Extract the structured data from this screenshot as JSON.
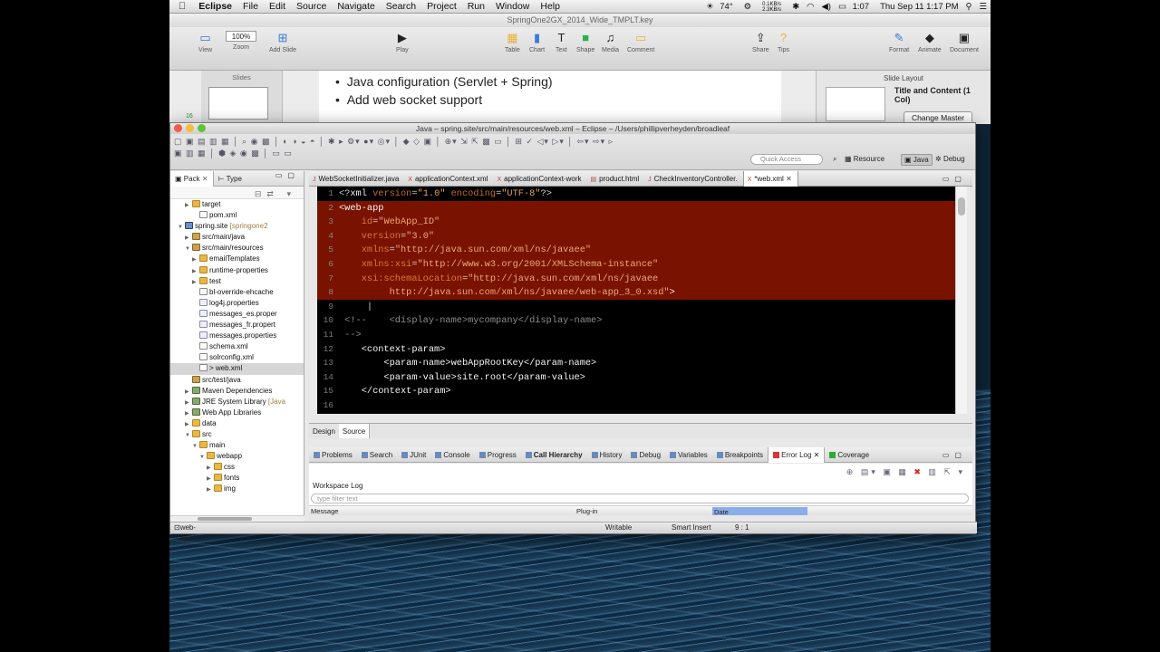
{
  "menubar": {
    "app": "Eclipse",
    "items": [
      "File",
      "Edit",
      "Source",
      "Navigate",
      "Search",
      "Project",
      "Run",
      "Window",
      "Help"
    ],
    "status": {
      "temp": "74°",
      "net_up": "0.1KB/s",
      "net_down": "2.3KB/s",
      "battery_time": "1:07",
      "datetime": "Thu Sep 11  1:17 PM"
    }
  },
  "keynote": {
    "title": "SpringOne2GX_2014_Wide_TMPLT.key",
    "toolbar": [
      {
        "label": "View",
        "icon": "view-icon"
      },
      {
        "label": "Zoom",
        "icon": "zoom-icon",
        "value": "100%"
      },
      {
        "label": "Add Slide",
        "icon": "plus-icon"
      },
      {
        "label": "Play",
        "icon": "play-icon"
      },
      {
        "label": "Table",
        "icon": "table-icon"
      },
      {
        "label": "Chart",
        "icon": "chart-icon"
      },
      {
        "label": "Text",
        "icon": "text-icon"
      },
      {
        "label": "Shape",
        "icon": "shape-icon"
      },
      {
        "label": "Media",
        "icon": "media-icon"
      },
      {
        "label": "Comment",
        "icon": "comment-icon"
      },
      {
        "label": "Share",
        "icon": "share-icon"
      },
      {
        "label": "Tips",
        "icon": "tips-icon"
      },
      {
        "label": "Format",
        "icon": "format-icon"
      },
      {
        "label": "Animate",
        "icon": "animate-icon"
      },
      {
        "label": "Document",
        "icon": "document-icon"
      }
    ],
    "slides_header": "Slides",
    "slide_number": "16",
    "bullets": [
      "Java configuration (Servlet + Spring)",
      "Add web socket support"
    ],
    "layout_header": "Slide Layout",
    "layout_name": "Title and Content (1 Col)",
    "change_master": "Change Master"
  },
  "eclipse": {
    "title": "Java – spring.site/src/main/resources/web.xml – Eclipse – /Users/phillipverheyden/broadleaf",
    "quick_access": "Quick Access",
    "perspectives": [
      "Resource",
      "Java",
      "Debug"
    ],
    "left_tabs": [
      "Pack",
      "Type"
    ],
    "tree": [
      {
        "label": "target",
        "type": "folder",
        "indent": 2,
        "tw": "▶"
      },
      {
        "label": "pom.xml",
        "type": "xml",
        "indent": 3,
        "tw": ""
      },
      {
        "label": "spring.site",
        "extra": "[springone2",
        "type": "proj",
        "indent": 1,
        "tw": "▼"
      },
      {
        "label": "src/main/java",
        "type": "pkgf",
        "indent": 2,
        "tw": "▶"
      },
      {
        "label": "src/main/resources",
        "type": "pkgf",
        "indent": 2,
        "tw": "▼"
      },
      {
        "label": "emailTemplates",
        "type": "folder",
        "indent": 3,
        "tw": "▶"
      },
      {
        "label": "runtime-properties",
        "type": "folder",
        "indent": 3,
        "tw": "▶"
      },
      {
        "label": "test",
        "type": "folder",
        "indent": 3,
        "tw": "▶"
      },
      {
        "label": "bl-override-ehcache",
        "type": "xml",
        "indent": 3,
        "tw": ""
      },
      {
        "label": "log4j.properties",
        "type": "prop",
        "indent": 3,
        "tw": ""
      },
      {
        "label": "messages_es.proper",
        "type": "prop",
        "indent": 3,
        "tw": ""
      },
      {
        "label": "messages_fr.propert",
        "type": "prop",
        "indent": 3,
        "tw": ""
      },
      {
        "label": "messages.properties",
        "type": "prop",
        "indent": 3,
        "tw": ""
      },
      {
        "label": "schema.xml",
        "type": "xml",
        "indent": 3,
        "tw": ""
      },
      {
        "label": "solrconfig.xml",
        "type": "xml",
        "indent": 3,
        "tw": ""
      },
      {
        "label": "> web.xml",
        "type": "xml",
        "indent": 3,
        "tw": "",
        "selected": true
      },
      {
        "label": "src/test/java",
        "type": "pkgf",
        "indent": 2,
        "tw": ""
      },
      {
        "label": "Maven Dependencies",
        "type": "lib",
        "indent": 2,
        "tw": "▶"
      },
      {
        "label": "JRE System Library",
        "extra": "[Java",
        "type": "lib",
        "indent": 2,
        "tw": "▶"
      },
      {
        "label": "Web App Libraries",
        "type": "lib",
        "indent": 2,
        "tw": "▶"
      },
      {
        "label": "data",
        "type": "folder",
        "indent": 2,
        "tw": "▶"
      },
      {
        "label": "src",
        "type": "folder",
        "indent": 2,
        "tw": "▼"
      },
      {
        "label": "main",
        "type": "folder",
        "indent": 3,
        "tw": "▼"
      },
      {
        "label": "webapp",
        "type": "folder",
        "indent": 4,
        "tw": "▼"
      },
      {
        "label": "css",
        "type": "folder",
        "indent": 5,
        "tw": "▶"
      },
      {
        "label": "fonts",
        "type": "folder",
        "indent": 5,
        "tw": "▶"
      },
      {
        "label": "img",
        "type": "folder",
        "indent": 5,
        "tw": "▶"
      }
    ],
    "editor_tabs": [
      "WebSocketInitializer.java",
      "applicationContext.xml",
      "applicationContext-work",
      "product.html",
      "CheckInventoryController.",
      "*web.xml"
    ],
    "code": [
      {
        "n": "1",
        "hl": false,
        "parts": [
          [
            "c-punc",
            "<?"
          ],
          [
            "c-tag",
            "xml"
          ],
          [
            "c-attr",
            " version"
          ],
          [
            "c-punc",
            "="
          ],
          [
            "c-str",
            "\"1.0\""
          ],
          [
            "c-attr",
            " encoding"
          ],
          [
            "c-punc",
            "="
          ],
          [
            "c-str",
            "\"UTF-8\""
          ],
          [
            "c-punc",
            "?>"
          ]
        ]
      },
      {
        "n": "2",
        "hl": true,
        "parts": [
          [
            "c-tag",
            "<web-app"
          ]
        ]
      },
      {
        "n": "3",
        "hl": true,
        "parts": [
          [
            "c-attr-hl",
            "    id"
          ],
          [
            "c-punc",
            "="
          ],
          [
            "c-str-hl",
            "\"WebApp_ID\""
          ]
        ]
      },
      {
        "n": "4",
        "hl": true,
        "parts": [
          [
            "c-attr-hl",
            "    version"
          ],
          [
            "c-punc",
            "="
          ],
          [
            "c-str-hl",
            "\"3.0\""
          ]
        ]
      },
      {
        "n": "5",
        "hl": true,
        "parts": [
          [
            "c-attr-hl",
            "    xmlns"
          ],
          [
            "c-punc",
            "="
          ],
          [
            "c-str-hl",
            "\"http://java.sun.com/xml/ns/javaee\""
          ]
        ]
      },
      {
        "n": "6",
        "hl": true,
        "parts": [
          [
            "c-attr-hl",
            "    xmlns:xsi"
          ],
          [
            "c-punc",
            "="
          ],
          [
            "c-str-hl",
            "\"http://www.w3.org/2001/XMLSchema-instance\""
          ]
        ]
      },
      {
        "n": "7",
        "hl": true,
        "parts": [
          [
            "c-attr-hl",
            "    xsi:schemaLocation"
          ],
          [
            "c-punc",
            "="
          ],
          [
            "c-str-hl",
            "\"http://java.sun.com/xml/ns/javaee"
          ]
        ]
      },
      {
        "n": "8",
        "hl": true,
        "parts": [
          [
            "c-str-hl",
            "         http://java.sun.com/xml/ns/javaee/web-app_3_0.xsd\""
          ],
          [
            "c-tag",
            ">"
          ]
        ]
      },
      {
        "n": "9",
        "hl": false,
        "parts": [
          [
            "c-punc",
            "     |"
          ]
        ]
      },
      {
        "n": "10",
        "hl": false,
        "parts": [
          [
            "c-com",
            " <!--    <display-name>mycompany</display-name>"
          ]
        ]
      },
      {
        "n": "11",
        "hl": false,
        "parts": [
          [
            "c-com",
            " -->"
          ]
        ]
      },
      {
        "n": "12",
        "hl": false,
        "parts": [
          [
            "c-tag",
            "    <context-param>"
          ]
        ]
      },
      {
        "n": "13",
        "hl": false,
        "parts": [
          [
            "c-tag",
            "        <param-name>webAppRootKey</param-name>"
          ]
        ]
      },
      {
        "n": "14",
        "hl": false,
        "parts": [
          [
            "c-tag",
            "        <param-value>site.root</param-value>"
          ]
        ]
      },
      {
        "n": "15",
        "hl": false,
        "parts": [
          [
            "c-tag",
            "    </context-param>"
          ]
        ]
      },
      {
        "n": "16",
        "hl": false,
        "parts": [
          [
            "c-tag",
            ""
          ]
        ]
      }
    ],
    "editor_modes": [
      "Design",
      "Source"
    ],
    "bottom_tabs": [
      "Problems",
      "Search",
      "JUnit",
      "Console",
      "Progress",
      "Call Hierarchy",
      "History",
      "Debug",
      "Variables",
      "Breakpoints",
      "Error Log",
      "Coverage"
    ],
    "log_title": "Workspace Log",
    "filter_placeholder": "type filter text",
    "columns": [
      "Message",
      "Plug-in",
      "Date"
    ],
    "status": {
      "path": "web-app",
      "writable": "Writable",
      "insert": "Smart Insert",
      "position": "9 : 1"
    }
  }
}
